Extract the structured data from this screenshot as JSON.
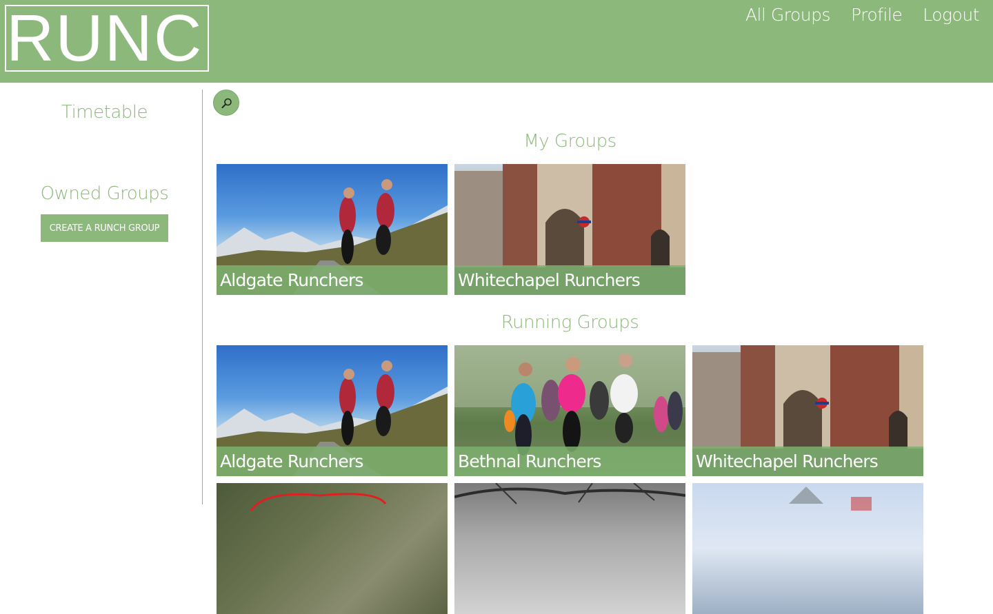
{
  "brand": {
    "logo_text": "RUNCH",
    "accent": "#8db87c"
  },
  "nav": {
    "items": [
      "All Groups",
      "Profile",
      "Logout"
    ]
  },
  "sidebar": {
    "timetable": "Timetable",
    "owned_groups": "Owned Groups",
    "create_button": "CREATE A RUNCH GROUP"
  },
  "search": {
    "icon": "magnifier-icon"
  },
  "my_groups": {
    "title": "My Groups",
    "cards": [
      {
        "name": "Aldgate Runchers",
        "image": "runners-mountain-road"
      },
      {
        "name": "Whitechapel Runchers",
        "image": "london-street-station"
      }
    ]
  },
  "running_groups": {
    "title": "Running Groups",
    "cards": [
      {
        "name": "Aldgate Runchers",
        "image": "runners-mountain-road"
      },
      {
        "name": "Bethnal Runchers",
        "image": "runners-park"
      },
      {
        "name": "Whitechapel Runchers",
        "image": "london-street-station"
      },
      {
        "name": "",
        "image": "map-route"
      },
      {
        "name": "",
        "image": "tree-branches-bw"
      },
      {
        "name": "",
        "image": "city-skyline"
      }
    ]
  }
}
